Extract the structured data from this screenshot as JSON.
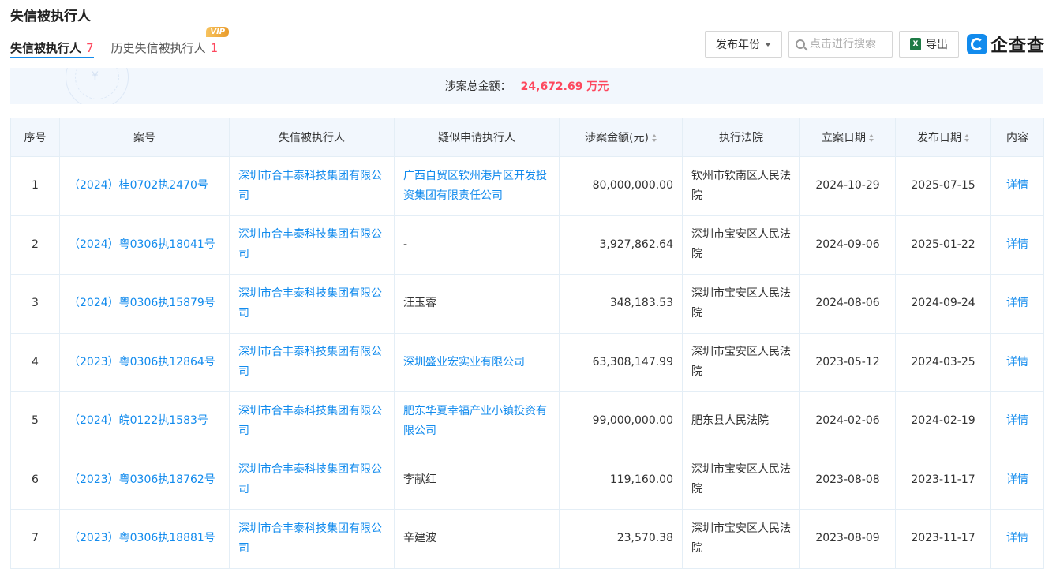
{
  "page_title": "失信被执行人",
  "tabs": [
    {
      "label": "失信被执行人",
      "count": "7"
    },
    {
      "label": "历史失信被执行人",
      "count": "1",
      "badge": "VIP"
    }
  ],
  "toolbar": {
    "year_filter": "发布年份",
    "search_placeholder": "点击进行搜索",
    "export_label": "导出",
    "logo_text": "企查查"
  },
  "summary": {
    "label": "涉案总金额：",
    "value": "24,672.69 万元",
    "watermark_symbol": "¥"
  },
  "table": {
    "headers": [
      "序号",
      "案号",
      "失信被执行人",
      "疑似申请执行人",
      "涉案金额(元)",
      "执行法院",
      "立案日期",
      "发布日期",
      "内容"
    ],
    "rows": [
      {
        "no": "1",
        "case": "（2024）桂0702执2470号",
        "debtor": "深圳市合丰泰科技集团有限公司",
        "applicant": "广西自贸区钦州港片区开发投资集团有限责任公司",
        "applicant_link": true,
        "amount": "80,000,000.00",
        "court": "钦州市钦南区人民法院",
        "filed": "2024-10-29",
        "published": "2025-07-15",
        "detail": "详情"
      },
      {
        "no": "2",
        "case": "（2024）粤0306执18041号",
        "debtor": "深圳市合丰泰科技集团有限公司",
        "applicant": "-",
        "applicant_link": false,
        "amount": "3,927,862.64",
        "court": "深圳市宝安区人民法院",
        "filed": "2024-09-06",
        "published": "2025-01-22",
        "detail": "详情"
      },
      {
        "no": "3",
        "case": "（2024）粤0306执15879号",
        "debtor": "深圳市合丰泰科技集团有限公司",
        "applicant": "汪玉蓉",
        "applicant_link": false,
        "amount": "348,183.53",
        "court": "深圳市宝安区人民法院",
        "filed": "2024-08-06",
        "published": "2024-09-24",
        "detail": "详情"
      },
      {
        "no": "4",
        "case": "（2023）粤0306执12864号",
        "debtor": "深圳市合丰泰科技集团有限公司",
        "applicant": "深圳盛业宏实业有限公司",
        "applicant_link": true,
        "amount": "63,308,147.99",
        "court": "深圳市宝安区人民法院",
        "filed": "2023-05-12",
        "published": "2024-03-25",
        "detail": "详情"
      },
      {
        "no": "5",
        "case": "（2024）皖0122执1583号",
        "debtor": "深圳市合丰泰科技集团有限公司",
        "applicant": "肥东华夏幸福产业小镇投资有限公司",
        "applicant_link": true,
        "amount": "99,000,000.00",
        "court": "肥东县人民法院",
        "filed": "2024-02-06",
        "published": "2024-02-19",
        "detail": "详情"
      },
      {
        "no": "6",
        "case": "（2023）粤0306执18762号",
        "debtor": "深圳市合丰泰科技集团有限公司",
        "applicant": "李献红",
        "applicant_link": false,
        "amount": "119,160.00",
        "court": "深圳市宝安区人民法院",
        "filed": "2023-08-08",
        "published": "2023-11-17",
        "detail": "详情"
      },
      {
        "no": "7",
        "case": "（2023）粤0306执18881号",
        "debtor": "深圳市合丰泰科技集团有限公司",
        "applicant": "辛建波",
        "applicant_link": false,
        "amount": "23,570.38",
        "court": "深圳市宝安区人民法院",
        "filed": "2023-08-09",
        "published": "2023-11-17",
        "detail": "详情"
      }
    ]
  },
  "colors": {
    "accent": "#128bed",
    "count_red": "#fd485e",
    "header_bg": "#f2f7fd"
  }
}
